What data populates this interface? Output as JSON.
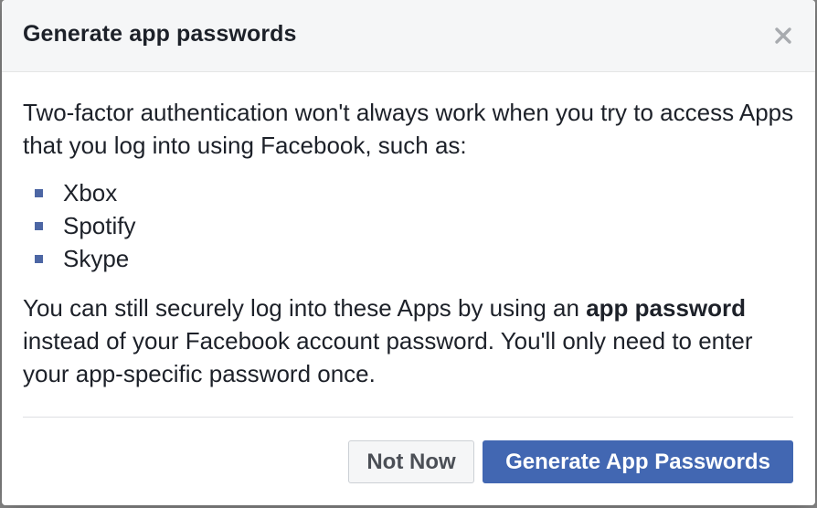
{
  "dialog": {
    "title": "Generate app passwords",
    "close_icon": "close-icon"
  },
  "body": {
    "intro": "Two-factor authentication won't always work when you try to access Apps that you log into using Facebook, such as:",
    "apps": [
      "Xbox",
      "Spotify",
      "Skype"
    ],
    "outro_before": "You can still securely log into these Apps by using an ",
    "outro_bold": "app password",
    "outro_after": " instead of your Facebook account password. You'll only need to enter your app-specific password once."
  },
  "footer": {
    "not_now_label": "Not Now",
    "generate_label": "Generate App Passwords"
  },
  "colors": {
    "primary": "#4267b2",
    "bullet": "#4c66a4",
    "text": "#1d2129",
    "header_bg": "#f5f6f7"
  }
}
